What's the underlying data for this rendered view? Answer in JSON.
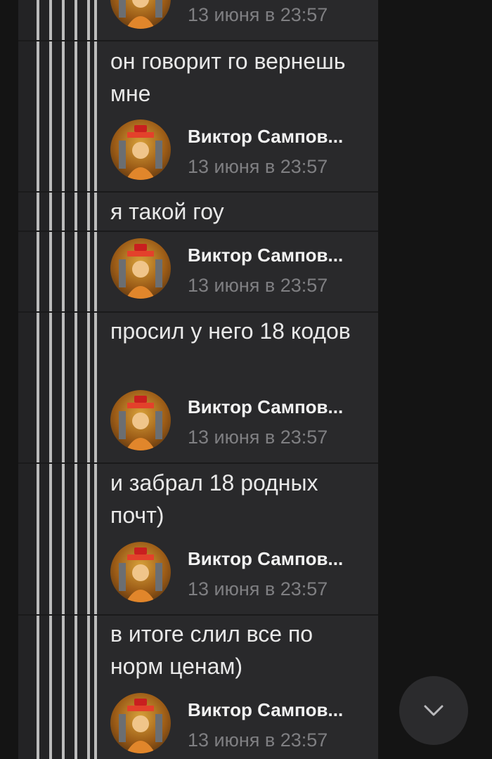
{
  "thread": {
    "comments": [
      {
        "author": "",
        "time": "13 июня в 23:57"
      },
      {
        "text": "он говорит го вернешь мне",
        "author": "Виктор Сампов...",
        "time": "13 июня в 23:57"
      },
      {
        "text": "я такой гоу",
        "author": "Виктор Сампов...",
        "time": "13 июня в 23:57"
      },
      {
        "text": "просил у него 18 кодов",
        "author": "Виктор Сампов...",
        "time": "13 июня в 23:57"
      },
      {
        "text": "и забрал 18 родных почт)",
        "author": "Виктор Сампов...",
        "time": "13 июня в 23:57"
      },
      {
        "text": "в итоге слил все по норм ценам)",
        "author": "Виктор Сампов...",
        "time": "13 июня в 23:57"
      }
    ]
  },
  "icons": {
    "avatar": "avatar-image",
    "scroll_down": "chevron-down-icon"
  },
  "colors": {
    "background": "#141414",
    "bubble": "#29292b",
    "text": "#e8e8e8",
    "muted": "#7f7f82",
    "thread_lines": "#bcbcbc"
  }
}
